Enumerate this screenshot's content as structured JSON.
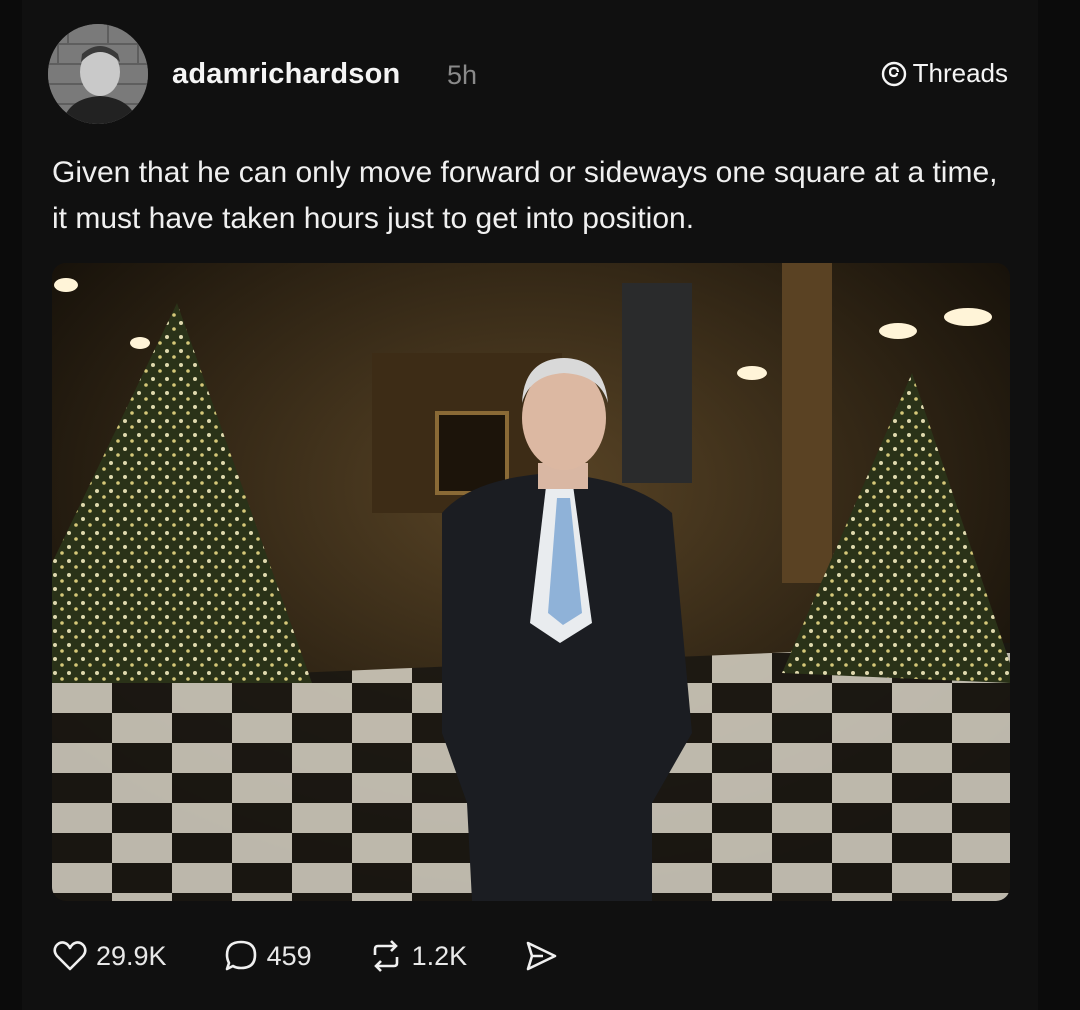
{
  "post": {
    "username": "adamrichardson",
    "time_ago": "5h",
    "brand_label": "Threads",
    "text": "Given that he can only move forward or sideways one square at a time, it must have taken hours just to get into position.",
    "stats": {
      "likes": "29.9K",
      "replies": "459",
      "reposts": "1.2K"
    },
    "icons": {
      "avatar": "avatar-image",
      "brand": "threads-logo-icon",
      "like": "heart-icon",
      "reply": "comment-bubble-icon",
      "repost": "repost-icon",
      "share": "send-icon"
    }
  },
  "colors": {
    "background": "#0b0b0b",
    "card": "#101010",
    "text": "#f0f0f0",
    "muted": "#8a8a8a"
  }
}
